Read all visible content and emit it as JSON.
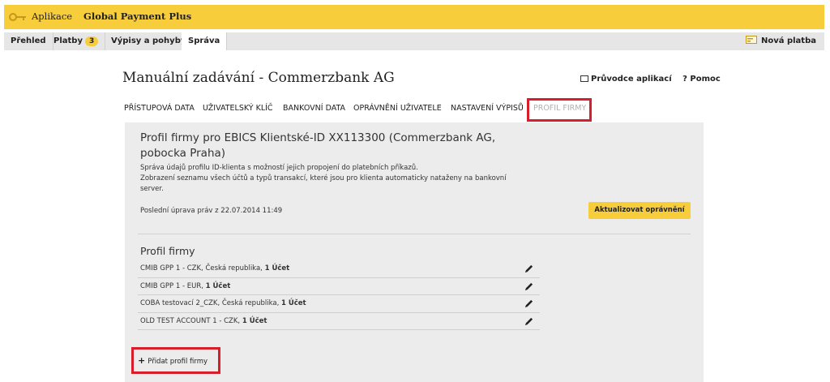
{
  "appbar": {
    "app_label": "Aplikace",
    "product": "Global Payment Plus",
    "key_icon": "key-icon",
    "accent": "#f7cd3c"
  },
  "tabs": {
    "overview": "Přehled",
    "payments": "Platby",
    "payments_count": "3",
    "statements": "Výpisy a pohyby",
    "admin": "Správa",
    "new_payment": "Nová platba"
  },
  "header": {
    "title": "Manuální zadávání - Commerzbank AG",
    "guide": "Průvodce aplikací",
    "help": "Pomoc"
  },
  "subnav": {
    "access_data": "PŘÍSTUPOVÁ DATA",
    "user_key": "UŽIVATELSKÝ KLÍČ",
    "bank_data": "BANKOVNÍ DATA",
    "user_rights": "OPRÁVNĚNÍ UŽIVATELE",
    "statement_settings": "NASTAVENÍ VÝPISŮ",
    "company_profile": "PROFIL FIRMY"
  },
  "panel": {
    "heading": "Profil firmy pro EBICS Klientské-ID XX113300 (Commerzbank AG, pobocka Praha)",
    "desc1": "Správa údajů profilu ID-klienta s možností jejich propojení do platebních příkazů.",
    "desc2": "Zobrazení seznamu všech účtů a typů transakcí, které jsou pro klienta automaticky nataženy na bankovní server.",
    "last_update": "Poslední úprava práv z 22.07.2014 11:49",
    "update_button": "Aktualizovat oprávnění",
    "profiles_heading": "Profil firmy",
    "profiles": [
      {
        "name": "CMIB GPP 1 - CZK, Česká republika, ",
        "count": "1 Účet"
      },
      {
        "name": "CMIB GPP 1 - EUR, ",
        "count": "1 Účet"
      },
      {
        "name": "COBA testovací 2_CZK, Česká republika, ",
        "count": "1 Účet"
      },
      {
        "name": "OLD TEST ACCOUNT 1 - CZK, ",
        "count": "1 Účet"
      }
    ],
    "add_button": "Přidat profil firmy"
  },
  "colors": {
    "highlight": "#d81e2b",
    "panel_bg": "#ececec"
  }
}
